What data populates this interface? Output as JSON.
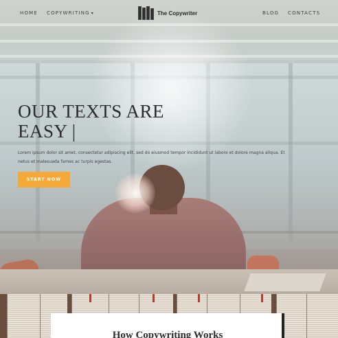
{
  "nav": {
    "left_links": [
      "HOME",
      "COPYWRITING"
    ],
    "right_links": [
      "BLOG",
      "CONTACTS"
    ],
    "dropdown_caret": "▾",
    "brand": "The Copywriter"
  },
  "hero": {
    "headline_line1": "OUR  TEXTS ARE",
    "headline_line2": "EASY",
    "cursor": "|",
    "lead": "Lorem ipsum dolor sit amet, consectetur adipiscing elit, sed do eiusmod tempor incididunt ut labore et dolore magna aliqua. Et netus et malesuada fames ac turpis egestas.",
    "cta_label": "START NOW"
  },
  "section": {
    "title": "How Copywriting Works"
  },
  "colors": {
    "accent": "#f5a938",
    "text_dark": "#2c2c2c"
  },
  "icons": {
    "logo": "books-icon",
    "dropdown": "chevron-down-icon"
  }
}
